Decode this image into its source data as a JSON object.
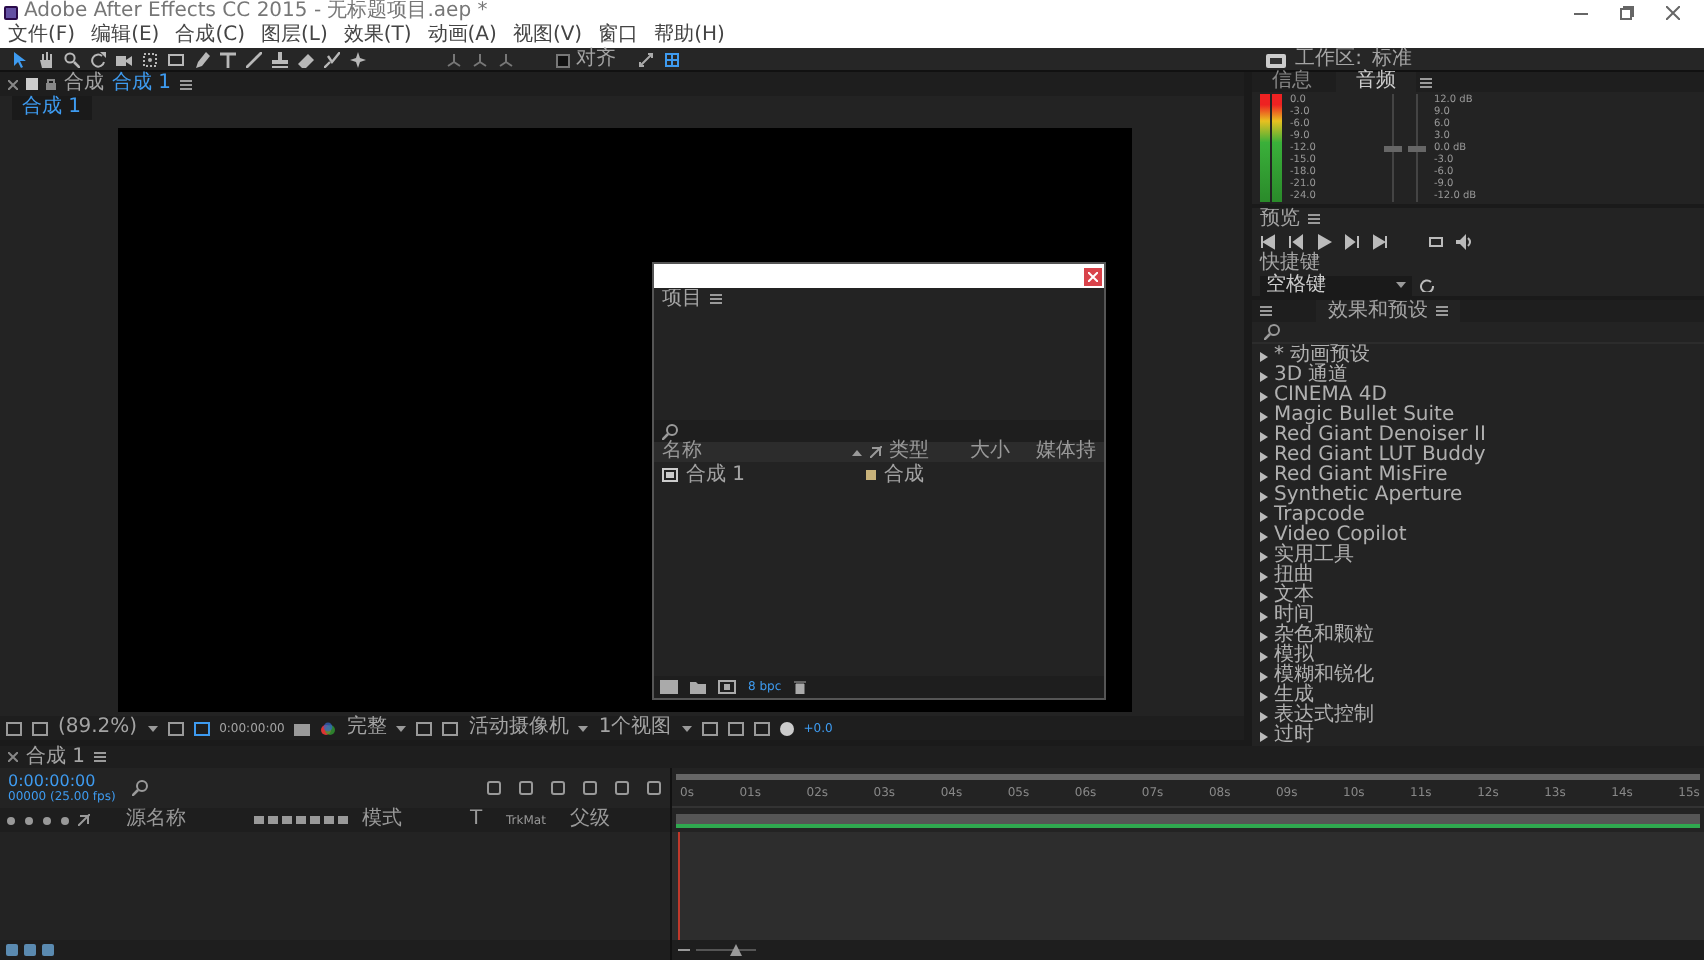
{
  "window": {
    "title": "Adobe After Effects CC 2015 - 无标题项目.aep *"
  },
  "menu": [
    "文件(F)",
    "编辑(E)",
    "合成(C)",
    "图层(L)",
    "效果(T)",
    "动画(A)",
    "视图(V)",
    "窗口",
    "帮助(H)"
  ],
  "toolbar": {
    "snap_label": "对齐",
    "snap_checked": false,
    "workspace_label": "工作区:",
    "workspace_value": "标准"
  },
  "composition_panel": {
    "tab_label": "合成",
    "tab_name": "合成 1",
    "view_tab": "合成 1",
    "zoom": "(89.2%)",
    "timecode": "0:00:00:00",
    "resolution": "完整",
    "camera": "活动摄像机",
    "views": "1个视图",
    "exposure": "+0.0"
  },
  "audio_panel": {
    "tabs": [
      {
        "label": "信息",
        "selected": false
      },
      {
        "label": "音频",
        "selected": true
      }
    ],
    "meter_scale": [
      "0.0",
      "-3.0",
      "-6.0",
      "-9.0",
      "-12.0",
      "-15.0",
      "-18.0",
      "-21.0",
      "-24.0"
    ],
    "sliders": [
      {
        "level": 0.5
      },
      {
        "level": 0.5
      }
    ],
    "db_scale": [
      "12.0 dB",
      "9.0",
      "6.0",
      "3.0",
      "0.0 dB",
      "-3.0",
      "-6.0",
      "-9.0",
      "-12.0 dB"
    ]
  },
  "preview_panel": {
    "title": "预览",
    "shortcut_label": "快捷键",
    "shortcut_value": "空格键"
  },
  "effects_panel": {
    "title": "效果和预设",
    "items": [
      "* 动画预设",
      "3D 通道",
      "CINEMA 4D",
      "Magic Bullet Suite",
      "Red Giant Denoiser II",
      "Red Giant LUT Buddy",
      "Red Giant MisFire",
      "Synthetic Aperture",
      "Trapcode",
      "Video Copilot",
      "实用工具",
      "扭曲",
      "文本",
      "时间",
      "杂色和颗粒",
      "模拟",
      "模糊和锐化",
      "生成",
      "表达式控制",
      "过时"
    ]
  },
  "project_window": {
    "title": "项目",
    "columns": [
      "名称",
      "类型",
      "大小",
      "媒体持"
    ],
    "rows": [
      {
        "name": "合成 1",
        "type": "合成"
      }
    ],
    "bit_depth": "8 bpc"
  },
  "timeline": {
    "tab": "合成 1",
    "timecode": "0:00:00:00",
    "frame_info": "00000 (25.00 fps)",
    "columns": [
      "源名称",
      "模式",
      "T",
      "TrkMat",
      "父级"
    ],
    "ruler": [
      "0s",
      "01s",
      "02s",
      "03s",
      "04s",
      "05s",
      "06s",
      "07s",
      "08s",
      "09s",
      "10s",
      "11s",
      "12s",
      "13s",
      "14s",
      "15s"
    ]
  }
}
